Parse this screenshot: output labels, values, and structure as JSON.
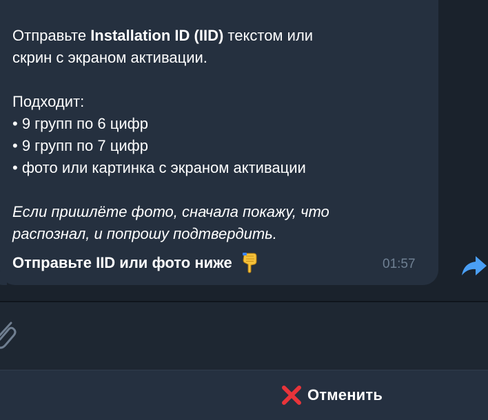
{
  "message": {
    "intro_pre": "Отправьте ",
    "intro_bold": "Installation ID (IID)",
    "intro_post": " текстом или",
    "intro_line2": "скрин с экраном активации.",
    "suits_title": "Подходит:",
    "bullets": [
      "• 9 групп по 6 цифр",
      "• 9 групп по 7 цифр",
      "• фото или картинка с экраном активации"
    ],
    "italic_line1": "Если пришлёте фото, сначала покажу, что",
    "italic_line2": "распознал, и попрошу подтвердить.",
    "cta": "Отправьте IID или фото ниже",
    "time": "01:57"
  },
  "icons": {
    "emoji": "backhand-index-pointing-down-icon",
    "forward": "forward-arrow-icon",
    "attach": "paperclip-icon",
    "cancel": "cross-mark-icon"
  },
  "keyboard": {
    "cancel_label": "Отменить"
  },
  "colors": {
    "background": "#1a222c",
    "bubble": "#25303f",
    "time": "#6f8093",
    "accent": "#4a9ff5",
    "cancel_red": "#e8343a"
  }
}
